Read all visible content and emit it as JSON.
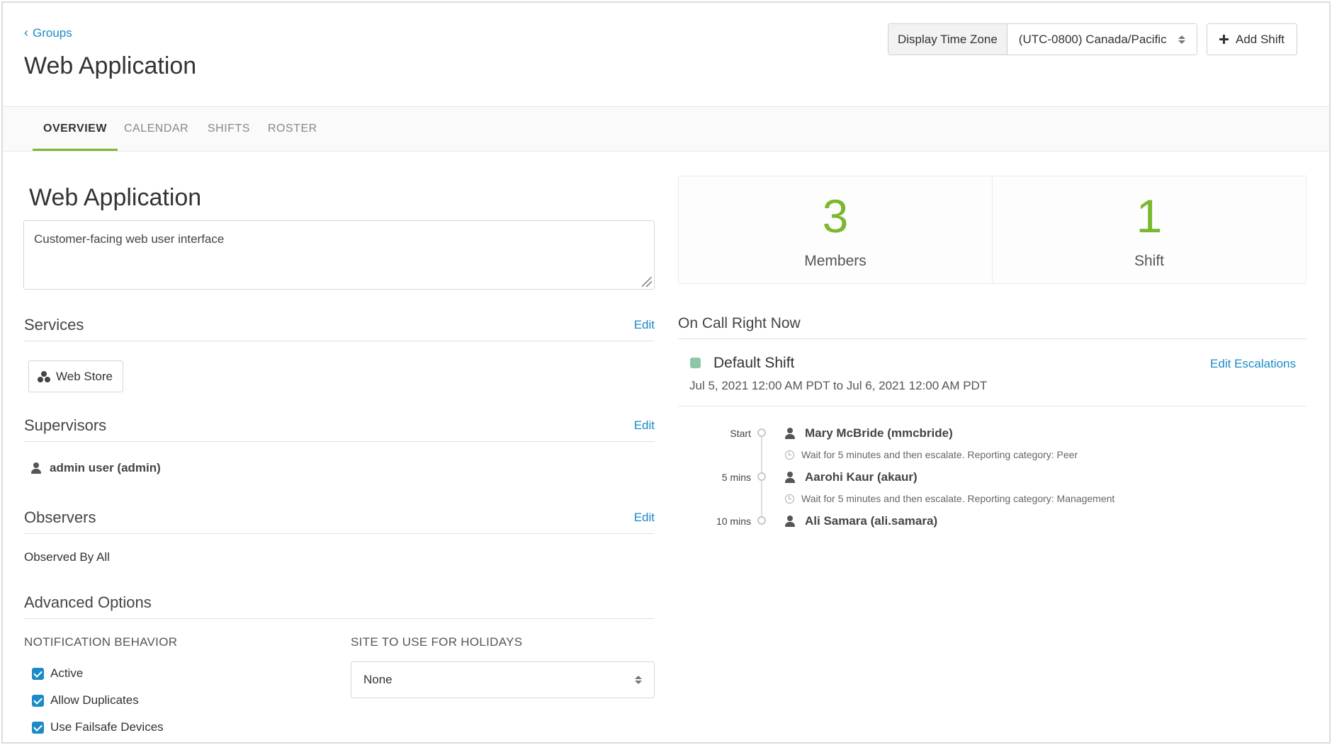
{
  "header": {
    "back_label": "Groups",
    "title": "Web Application",
    "tz_label": "Display Time Zone",
    "tz_value": "(UTC-0800) Canada/Pacific",
    "add_shift_label": "Add Shift"
  },
  "tabs": [
    {
      "label": "OVERVIEW",
      "active": true
    },
    {
      "label": "CALENDAR",
      "active": false
    },
    {
      "label": "SHIFTS",
      "active": false
    },
    {
      "label": "ROSTER",
      "active": false
    }
  ],
  "overview": {
    "group_name": "Web Application",
    "description": "Customer-facing web user interface",
    "services": {
      "title": "Services",
      "edit_label": "Edit",
      "items": [
        "Web Store"
      ]
    },
    "supervisors": {
      "title": "Supervisors",
      "edit_label": "Edit",
      "items": [
        "admin user (admin)"
      ]
    },
    "observers": {
      "title": "Observers",
      "edit_label": "Edit",
      "text": "Observed By All"
    },
    "advanced": {
      "title": "Advanced Options",
      "notification_label": "NOTIFICATION BEHAVIOR",
      "holiday_label": "SITE TO USE FOR HOLIDAYS",
      "holiday_value": "None",
      "checkboxes": [
        {
          "label": "Active",
          "checked": true
        },
        {
          "label": "Allow Duplicates",
          "checked": true
        },
        {
          "label": "Use Failsafe Devices",
          "checked": true
        }
      ]
    }
  },
  "stats": [
    {
      "value": "3",
      "label": "Members"
    },
    {
      "value": "1",
      "label": "Shift"
    }
  ],
  "oncall": {
    "title": "On Call Right Now",
    "shift_name": "Default Shift",
    "shift_color": "#8fc6a7",
    "shift_time": "Jul 5, 2021 12:00 AM PDT to Jul 6, 2021 12:00 AM PDT",
    "edit_escalations_label": "Edit Escalations",
    "escalations": [
      {
        "time": "Start",
        "user": "Mary McBride (mmcbride)"
      },
      {
        "note": "Wait for 5 minutes and then escalate. Reporting category: Peer"
      },
      {
        "time": "5 mins",
        "user": "Aarohi Kaur (akaur)"
      },
      {
        "note": "Wait for 5 minutes and then escalate. Reporting category: Management"
      },
      {
        "time": "10 mins",
        "user": "Ali Samara (ali.samara)"
      }
    ]
  },
  "colors": {
    "accent_green": "#7ab82e",
    "link_blue": "#1a8bc7"
  }
}
